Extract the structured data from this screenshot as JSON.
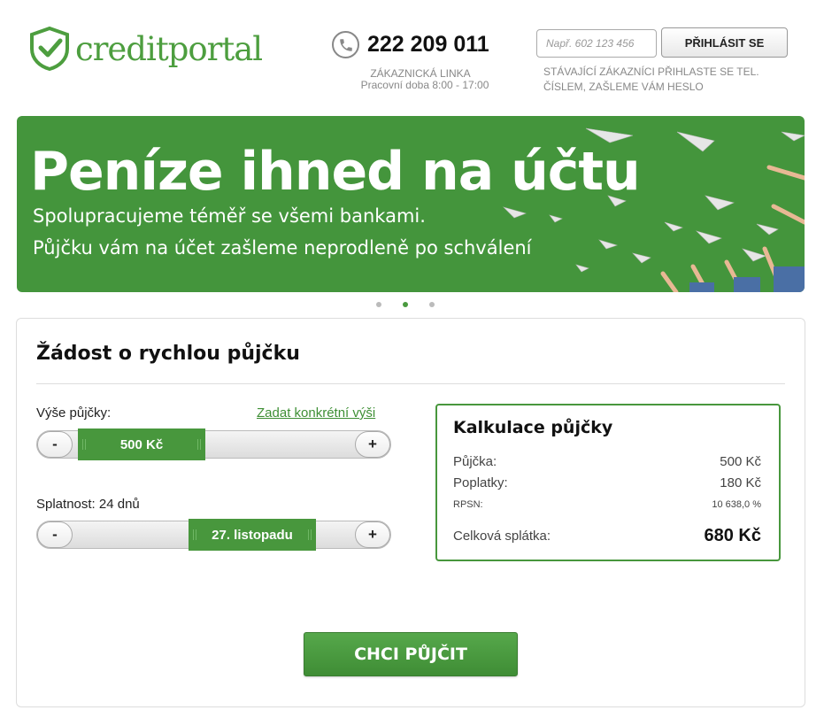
{
  "brand": {
    "name": "creditportal",
    "accent_color": "#4d9e3f",
    "logo_icon": "shield-check-icon"
  },
  "header": {
    "phone_icon": "phone-icon",
    "phone_number": "222 209 011",
    "hotline_label": "Zákaznická linka",
    "hotline_hours": "Pracovní doba 8:00 - 17:00",
    "login": {
      "phone_placeholder": "Např. 602 123 456",
      "button_label": "PŘIHLÁSIT SE",
      "note": "Stávající zákazníci přihlaste se tel. číslem, zašleme vám heslo"
    }
  },
  "banner": {
    "title": "Peníze ihned na účtu",
    "line1": "Spolupracujeme téměř se všemi bankami.",
    "line2": "Půjčku vám na účet zašleme neprodleně po schválení",
    "background_color": "#44953c",
    "slides": 3,
    "active_slide": 2
  },
  "loan_form": {
    "title": "Žádost o rychlou půjčku",
    "amount": {
      "label": "Výše půjčky:",
      "custom_link": "Zadat konkrétní výši",
      "value": "500 Kč",
      "minus": "-",
      "plus": "+"
    },
    "term": {
      "label": "Splatnost: 24 dnů",
      "value": "27. listopadu",
      "minus": "-",
      "plus": "+"
    },
    "calculation": {
      "title": "Kalkulace půjčky",
      "loan_label": "Půjčka:",
      "loan_value": "500 Kč",
      "fees_label": "Poplatky:",
      "fees_value": "180 Kč",
      "rpsn_label": "RPSN:",
      "rpsn_value": "10 638,0 %",
      "total_label": "Celková splátka:",
      "total_value": "680 Kč"
    },
    "submit_label": "CHCI PŮJČIT"
  }
}
